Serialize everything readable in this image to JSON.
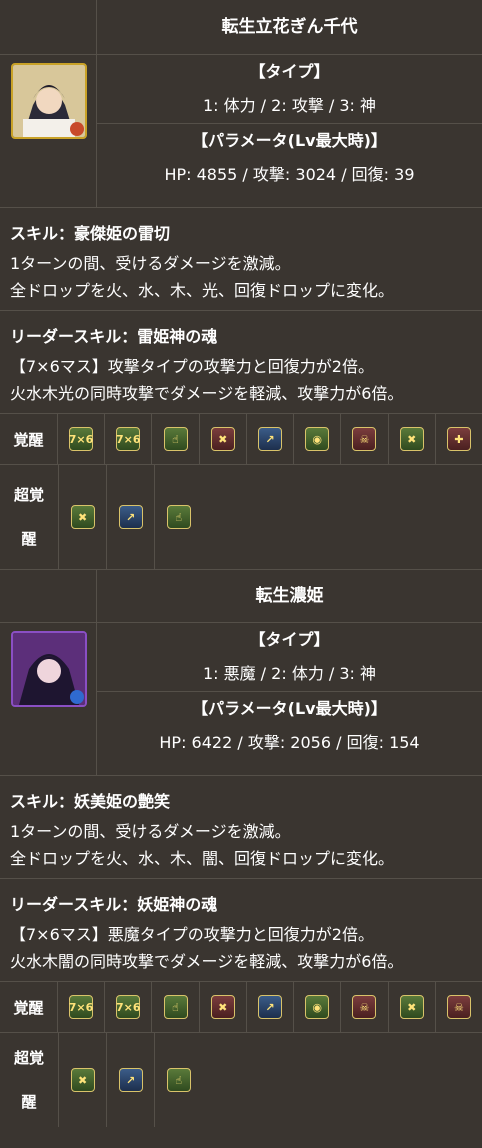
{
  "monsters": [
    {
      "name": "転生立花ぎん千代",
      "type_header": "【タイプ】",
      "types": "1: 体力 / 2: 攻撃 / 3: 神",
      "param_header": "【パラメータ(Lv最大時)】",
      "params": "HP: 4855 / 攻撃: 3024 / 回復: 39",
      "skill_title": "スキル：豪傑姫の雷切",
      "skill_lines": [
        "1ターンの間、受けるダメージを激減。",
        "全ドロップを火、水、木、光、回復ドロップに変化。"
      ],
      "leader_title": "リーダースキル：雷姫神の魂",
      "leader_lines": [
        "【7×6マス】攻撃タイプの攻撃力と回復力が2倍。",
        "火水木光の同時攻撃でダメージを軽減、攻撃力が6倍。"
      ],
      "awaken_label": "覚醒",
      "super_label_1": "超覚",
      "super_label_2": "醒"
    },
    {
      "name": "転生濃姫",
      "type_header": "【タイプ】",
      "types": "1: 悪魔 / 2: 体力 / 3: 神",
      "param_header": "【パラメータ(Lv最大時)】",
      "params": "HP: 6422 / 攻撃: 2056 / 回復: 154",
      "skill_title": "スキル：妖美姫の艶笑",
      "skill_lines": [
        "1ターンの間、受けるダメージを激減。",
        "全ドロップを火、水、木、闇、回復ドロップに変化。"
      ],
      "leader_title": "リーダースキル：妖姫神の魂",
      "leader_lines": [
        "【7×6マス】悪魔タイプの攻撃力と回復力が2倍。",
        "火水木闇の同時攻撃でダメージを軽減、攻撃力が6倍。"
      ],
      "awaken_label": "覚醒",
      "super_label_1": "超覚",
      "super_label_2": "醒"
    }
  ],
  "icons": {
    "i7x6": "7×6",
    "finger": "☝",
    "block": "✖",
    "arrow": "↗",
    "guard": "◉",
    "skull": "☠",
    "combo": "✚"
  }
}
